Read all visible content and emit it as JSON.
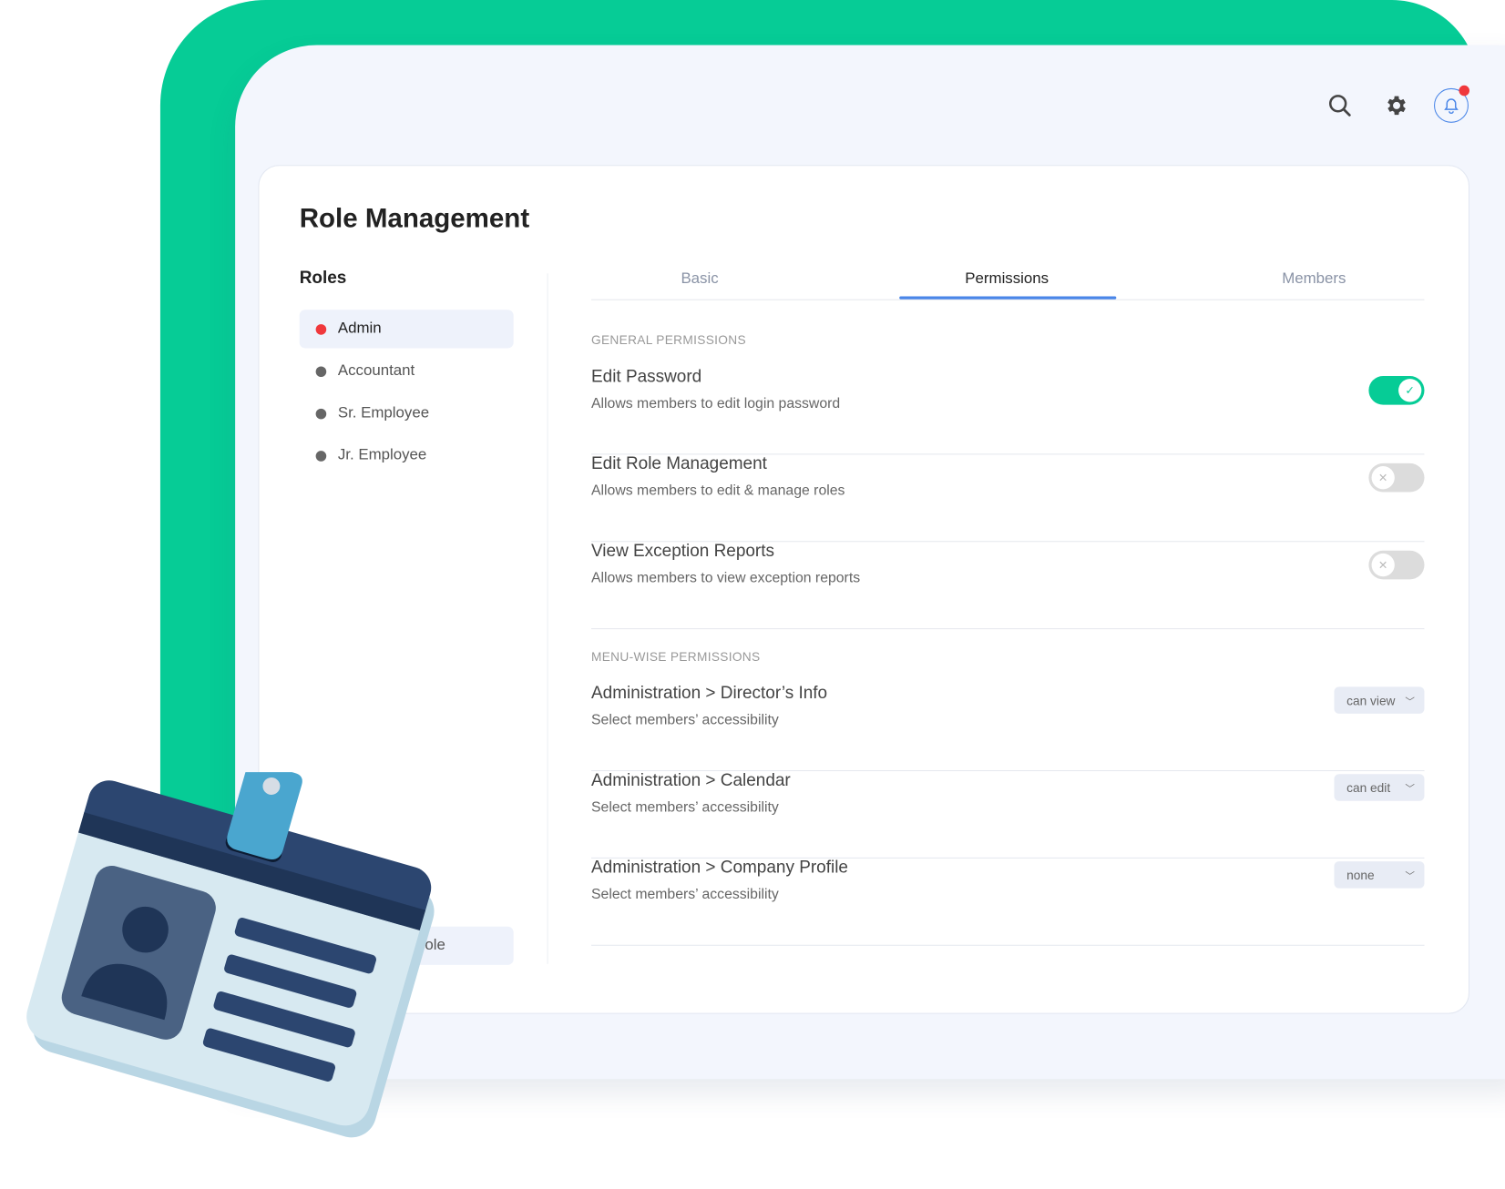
{
  "colors": {
    "brand_green": "#06cc96",
    "accent_blue": "#4a86e8",
    "alert_red": "#f0383c",
    "panel_bg": "#f3f6fd"
  },
  "header": {
    "icons": [
      "search-icon",
      "gear-icon",
      "bell-icon"
    ],
    "notification_dot": true
  },
  "page": {
    "title": "Role Management"
  },
  "roles": {
    "heading": "Roles",
    "items": [
      {
        "label": "Admin",
        "active": true,
        "color": "#f0383c"
      },
      {
        "label": "Accountant",
        "active": false,
        "color": "#666666"
      },
      {
        "label": "Sr. Employee",
        "active": false,
        "color": "#666666"
      },
      {
        "label": "Jr. Employee",
        "active": false,
        "color": "#666666"
      }
    ],
    "add_button_visible_text": "role"
  },
  "tabs": [
    {
      "label": "Basic"
    },
    {
      "label": "Permissions",
      "active": true
    },
    {
      "label": "Members"
    }
  ],
  "general": {
    "heading": "GENERAL PERMISSIONS",
    "items": [
      {
        "name": "Edit Password",
        "desc": "Allows members to edit login password",
        "enabled": true
      },
      {
        "name": "Edit Role Management",
        "desc": "Allows members to edit & manage roles",
        "enabled": false
      },
      {
        "name": "View Exception Reports",
        "desc": "Allows members to view exception reports",
        "enabled": false
      }
    ]
  },
  "menuwise": {
    "heading": "MENU-WISE PERMISSIONS",
    "items": [
      {
        "name": "Administration > Director’s Info",
        "desc": "Select members’ accessibility",
        "value": "can view"
      },
      {
        "name": "Administration > Calendar",
        "desc": "Select members’ accessibility",
        "value": "can edit"
      },
      {
        "name": "Administration > Company Profile",
        "desc": "Select members’ accessibility",
        "value": "none"
      }
    ]
  }
}
